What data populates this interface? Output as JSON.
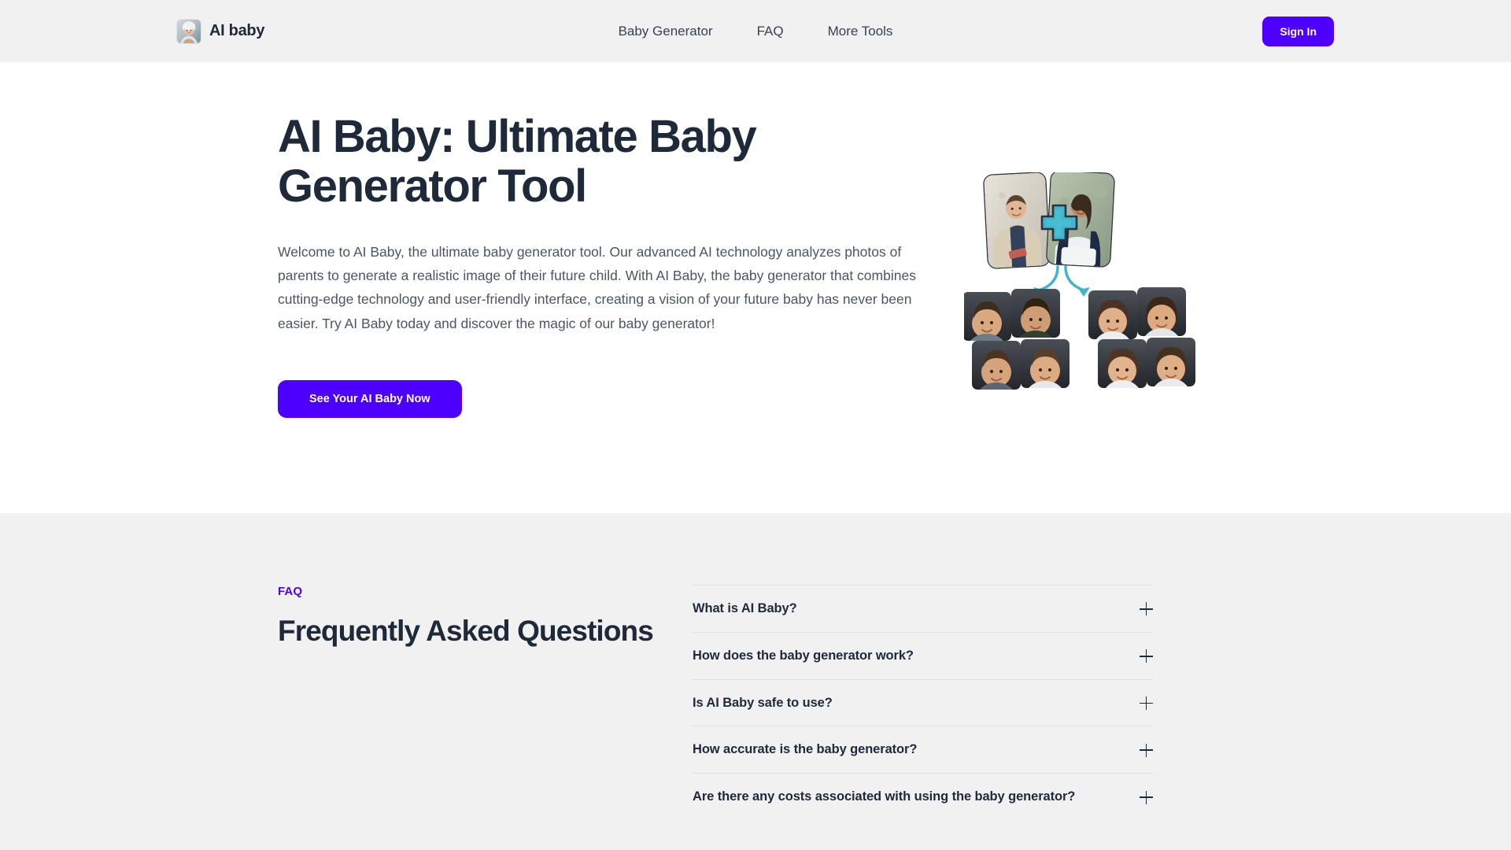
{
  "header": {
    "brand": {
      "name": "AI baby",
      "logo_icon": "baby-photo-logo"
    },
    "nav": [
      {
        "label": "Baby Generator"
      },
      {
        "label": "FAQ"
      },
      {
        "label": "More Tools"
      }
    ],
    "signin_label": "Sign In",
    "background": "#f1f1f1"
  },
  "hero": {
    "title": "AI Baby: Ultimate Baby Generator Tool",
    "paragraph": "Welcome to AI Baby, the ultimate baby generator tool. Our advanced AI technology analyzes photos of parents to generate a realistic image of their future child. With AI Baby, the baby generator that combines cutting-edge technology and user-friendly interface, creating a vision of your future baby has never been easier. Try AI Baby today and discover the magic of our baby generator!",
    "cta_label": "See Your AI Baby Now",
    "illustration": {
      "name": "parents-plus-babies-illustration",
      "parent_cards": 2,
      "plus_icon": "teal-plus-icon",
      "arrow_icon": "teal-fork-arrow-icon",
      "baby_grid_left": "4 boy results",
      "baby_grid_right": "4 girl results"
    }
  },
  "faq": {
    "eyebrow": "FAQ",
    "heading": "Frequently Asked Questions",
    "items": [
      {
        "question": "What is AI Baby?",
        "toggle_icon": "plus-icon"
      },
      {
        "question": "How does the baby generator work?",
        "toggle_icon": "plus-icon"
      },
      {
        "question": "Is AI Baby safe to use?",
        "toggle_icon": "plus-icon"
      },
      {
        "question": "How accurate is the baby generator?",
        "toggle_icon": "plus-icon"
      },
      {
        "question": "Are there any costs associated with using the baby generator?",
        "toggle_icon": "plus-icon"
      }
    ],
    "background": "#f1f1f1"
  },
  "colors": {
    "accent": "#4d00ff",
    "text_dark": "#1e2939",
    "text_body": "#4a5565",
    "teal": "#3fb6cc",
    "surface_gray": "#f1f1f1"
  }
}
